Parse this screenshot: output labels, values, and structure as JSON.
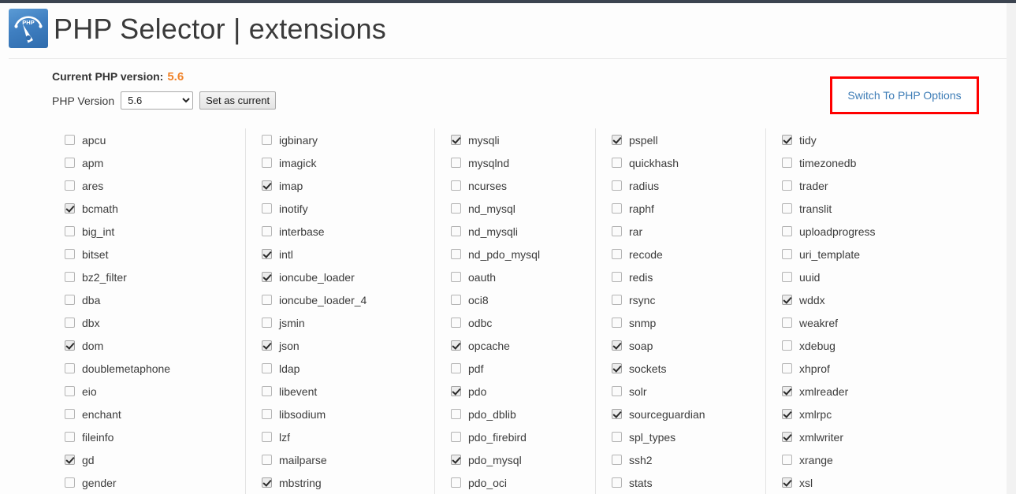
{
  "window": {
    "title": "PHP Selector | extensions"
  },
  "header": {
    "logo_icon": "php-speedometer-logo",
    "logo_text": "PHP",
    "title": "PHP Selector | extensions"
  },
  "version_panel": {
    "current_version_label": "Current PHP version:",
    "current_version_value": "5.6",
    "select_label": "PHP Version",
    "selected_version": "5.6",
    "version_options": [
      "5.6"
    ],
    "set_as_current_label": "Set as current"
  },
  "switch_button": {
    "label": "Switch To PHP Options",
    "link_color": "#3d7cb6",
    "highlight_border_color": "#ff0000"
  },
  "colors": {
    "accent_orange": "#f0832a",
    "link_blue": "#3d7cb6",
    "topbar_dark": "#3c4450",
    "logo_blue": "#3f7fc1",
    "page_background": "#fdfdfd"
  },
  "extensions": {
    "columns": [
      {
        "index": 0,
        "items": [
          {
            "name": "apcu",
            "checked": false
          },
          {
            "name": "apm",
            "checked": false
          },
          {
            "name": "ares",
            "checked": false
          },
          {
            "name": "bcmath",
            "checked": true
          },
          {
            "name": "big_int",
            "checked": false
          },
          {
            "name": "bitset",
            "checked": false
          },
          {
            "name": "bz2_filter",
            "checked": false
          },
          {
            "name": "dba",
            "checked": false
          },
          {
            "name": "dbx",
            "checked": false
          },
          {
            "name": "dom",
            "checked": true
          },
          {
            "name": "doublemetaphone",
            "checked": false
          },
          {
            "name": "eio",
            "checked": false
          },
          {
            "name": "enchant",
            "checked": false
          },
          {
            "name": "fileinfo",
            "checked": false
          },
          {
            "name": "gd",
            "checked": true
          },
          {
            "name": "gender",
            "checked": false
          }
        ]
      },
      {
        "index": 1,
        "items": [
          {
            "name": "igbinary",
            "checked": false
          },
          {
            "name": "imagick",
            "checked": false
          },
          {
            "name": "imap",
            "checked": true
          },
          {
            "name": "inotify",
            "checked": false
          },
          {
            "name": "interbase",
            "checked": false
          },
          {
            "name": "intl",
            "checked": true
          },
          {
            "name": "ioncube_loader",
            "checked": true
          },
          {
            "name": "ioncube_loader_4",
            "checked": false
          },
          {
            "name": "jsmin",
            "checked": false
          },
          {
            "name": "json",
            "checked": true
          },
          {
            "name": "ldap",
            "checked": false
          },
          {
            "name": "libevent",
            "checked": false
          },
          {
            "name": "libsodium",
            "checked": false
          },
          {
            "name": "lzf",
            "checked": false
          },
          {
            "name": "mailparse",
            "checked": false
          },
          {
            "name": "mbstring",
            "checked": true
          }
        ]
      },
      {
        "index": 2,
        "items": [
          {
            "name": "mysqli",
            "checked": true
          },
          {
            "name": "mysqlnd",
            "checked": false
          },
          {
            "name": "ncurses",
            "checked": false
          },
          {
            "name": "nd_mysql",
            "checked": false
          },
          {
            "name": "nd_mysqli",
            "checked": false
          },
          {
            "name": "nd_pdo_mysql",
            "checked": false
          },
          {
            "name": "oauth",
            "checked": false
          },
          {
            "name": "oci8",
            "checked": false
          },
          {
            "name": "odbc",
            "checked": false
          },
          {
            "name": "opcache",
            "checked": true
          },
          {
            "name": "pdf",
            "checked": false
          },
          {
            "name": "pdo",
            "checked": true
          },
          {
            "name": "pdo_dblib",
            "checked": false
          },
          {
            "name": "pdo_firebird",
            "checked": false
          },
          {
            "name": "pdo_mysql",
            "checked": true
          },
          {
            "name": "pdo_oci",
            "checked": false
          }
        ]
      },
      {
        "index": 3,
        "items": [
          {
            "name": "pspell",
            "checked": true
          },
          {
            "name": "quickhash",
            "checked": false
          },
          {
            "name": "radius",
            "checked": false
          },
          {
            "name": "raphf",
            "checked": false
          },
          {
            "name": "rar",
            "checked": false
          },
          {
            "name": "recode",
            "checked": false
          },
          {
            "name": "redis",
            "checked": false
          },
          {
            "name": "rsync",
            "checked": false
          },
          {
            "name": "snmp",
            "checked": false
          },
          {
            "name": "soap",
            "checked": true
          },
          {
            "name": "sockets",
            "checked": true
          },
          {
            "name": "solr",
            "checked": false
          },
          {
            "name": "sourceguardian",
            "checked": true
          },
          {
            "name": "spl_types",
            "checked": false
          },
          {
            "name": "ssh2",
            "checked": false
          },
          {
            "name": "stats",
            "checked": false
          }
        ]
      },
      {
        "index": 4,
        "items": [
          {
            "name": "tidy",
            "checked": true
          },
          {
            "name": "timezonedb",
            "checked": false
          },
          {
            "name": "trader",
            "checked": false
          },
          {
            "name": "translit",
            "checked": false
          },
          {
            "name": "uploadprogress",
            "checked": false
          },
          {
            "name": "uri_template",
            "checked": false
          },
          {
            "name": "uuid",
            "checked": false
          },
          {
            "name": "wddx",
            "checked": true
          },
          {
            "name": "weakref",
            "checked": false
          },
          {
            "name": "xdebug",
            "checked": false
          },
          {
            "name": "xhprof",
            "checked": false
          },
          {
            "name": "xmlreader",
            "checked": true
          },
          {
            "name": "xmlrpc",
            "checked": true
          },
          {
            "name": "xmlwriter",
            "checked": true
          },
          {
            "name": "xrange",
            "checked": false
          },
          {
            "name": "xsl",
            "checked": true
          }
        ]
      }
    ]
  }
}
